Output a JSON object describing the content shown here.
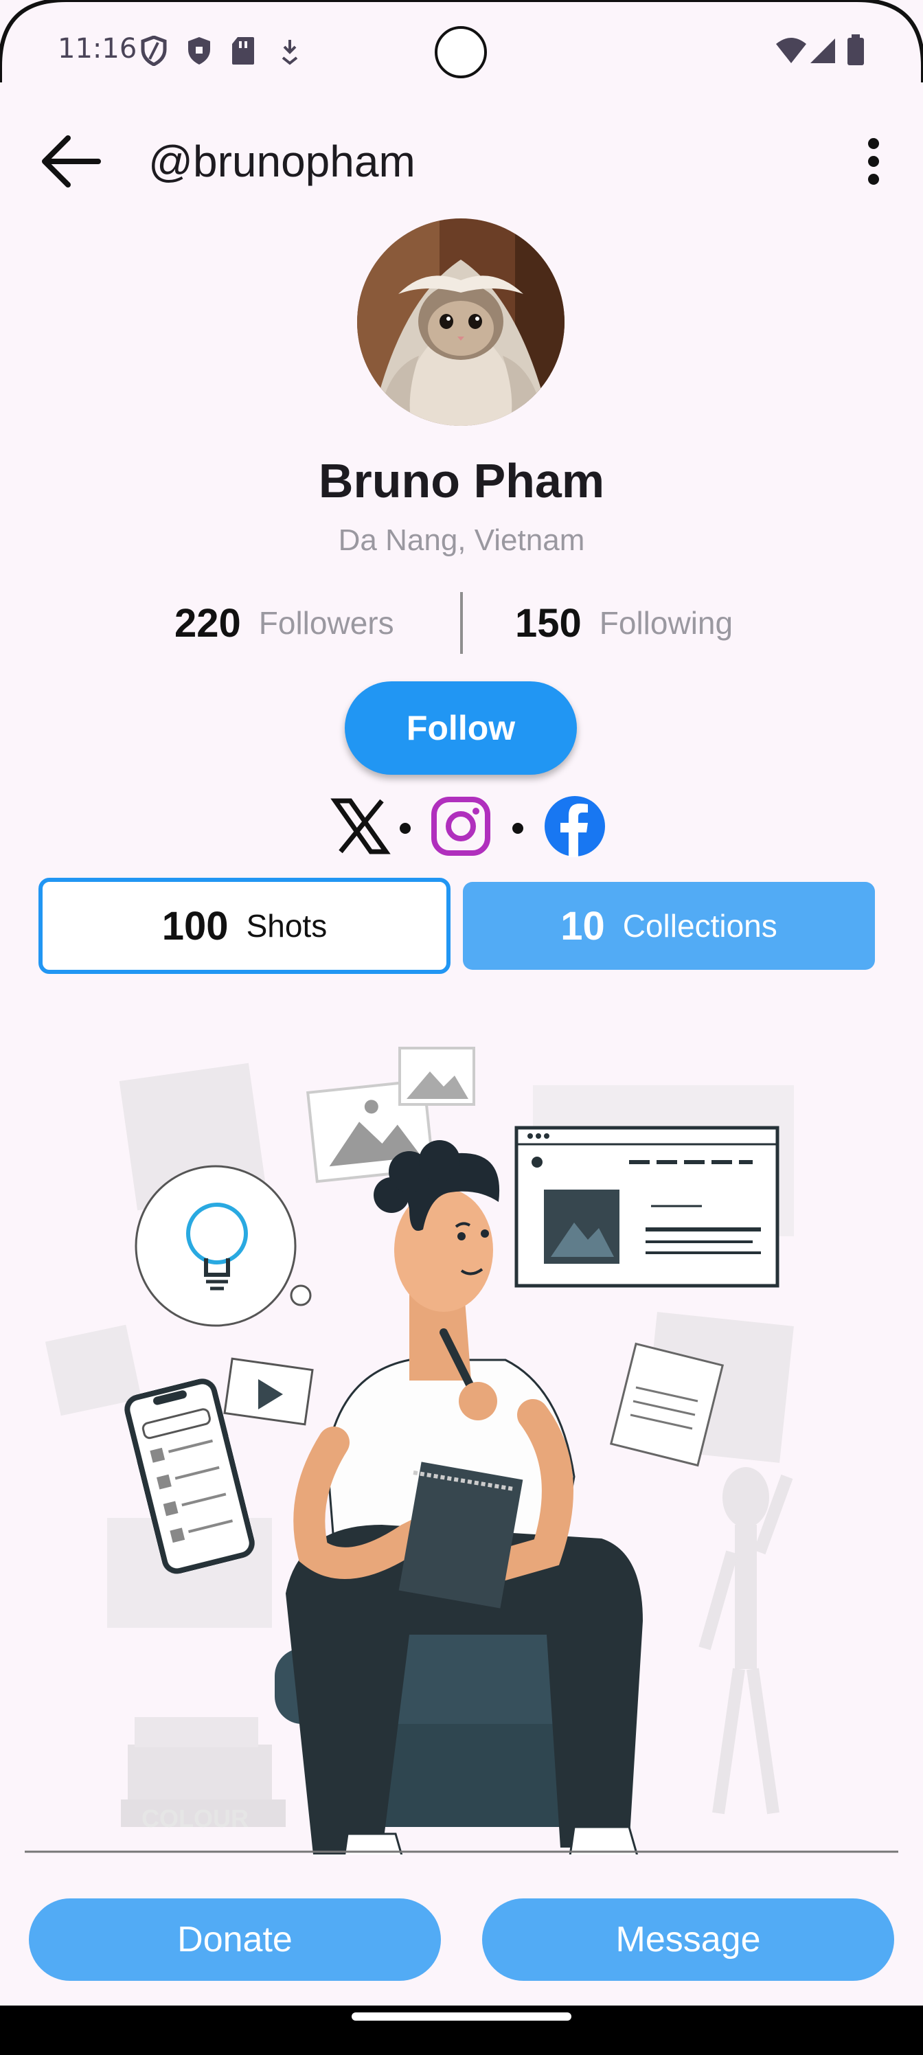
{
  "status_bar": {
    "time": "11:16",
    "left_icons": [
      "vpn-shield-icon",
      "shield-icon",
      "sd-card-icon",
      "download-icon"
    ],
    "right_icons": [
      "wifi-icon",
      "cellular-icon",
      "battery-icon"
    ]
  },
  "app_bar": {
    "back_icon": "arrow-back-icon",
    "handle": "@brunopham",
    "more_icon": "more-vert-icon"
  },
  "profile": {
    "name": "Bruno Pham",
    "location": "Da Nang, Vietnam",
    "followers_count": "220",
    "followers_label": "Followers",
    "following_count": "150",
    "following_label": "Following"
  },
  "follow_label": "Follow",
  "socials": [
    "x-icon",
    "instagram-icon",
    "facebook-icon"
  ],
  "tabs": {
    "shots_count": "100",
    "shots_label": "Shots",
    "collections_count": "10",
    "collections_label": "Collections",
    "selected": "Shots"
  },
  "illustration_caption_text": "COLOUR",
  "bottom_buttons": {
    "donate": "Donate",
    "message": "Message"
  },
  "colors": {
    "background": "#fcf5fb",
    "primary": "#2196f3",
    "secondary_button": "#52abf5",
    "instagram": "#b02fbd",
    "facebook": "#1877f2"
  }
}
